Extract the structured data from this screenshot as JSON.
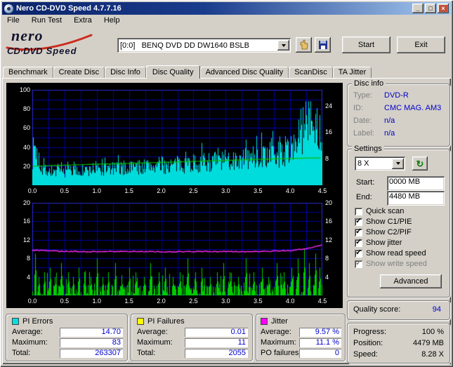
{
  "window": {
    "title": "Nero CD-DVD Speed 4.7.7.16",
    "menu": [
      "File",
      "Run Test",
      "Extra",
      "Help"
    ]
  },
  "icons": {
    "minimize": "_",
    "maximize": "□",
    "close": "×",
    "check": "✓",
    "refresh": "↻"
  },
  "logo": {
    "brand": "nero",
    "product_a": "CD·DVD",
    "product_b": "Speed"
  },
  "toolbar": {
    "drive": "[0:0]   BENQ DVD DD DW1640 BSLB",
    "start": "Start",
    "exit": "Exit"
  },
  "tabs": {
    "items": [
      "Benchmark",
      "Create Disc",
      "Disc Info",
      "Disc Quality",
      "Advanced Disc Quality",
      "ScanDisc",
      "TA Jitter"
    ],
    "selected": "Disc Quality"
  },
  "disc_info": {
    "title": "Disc info",
    "rows": [
      [
        "Type:",
        "DVD-R"
      ],
      [
        "ID:",
        "CMC MAG. AM3"
      ],
      [
        "Date:",
        "n/a"
      ],
      [
        "Label:",
        "n/a"
      ]
    ]
  },
  "settings": {
    "title": "Settings",
    "speed": "8 X",
    "start_label": "Start:",
    "start_value": "0000 MB",
    "end_label": "End:",
    "end_value": "4480 MB",
    "checkboxes": [
      {
        "label": "Quick scan",
        "checked": false,
        "disabled": false
      },
      {
        "label": "Show C1/PIE",
        "checked": true,
        "disabled": false
      },
      {
        "label": "Show C2/PIF",
        "checked": true,
        "disabled": false
      },
      {
        "label": "Show jitter",
        "checked": true,
        "disabled": false
      },
      {
        "label": "Show read speed",
        "checked": true,
        "disabled": false
      },
      {
        "label": "Show write speed",
        "checked": true,
        "disabled": true
      }
    ],
    "advanced": "Advanced"
  },
  "quality": {
    "label": "Quality score:",
    "value": "94"
  },
  "status": {
    "rows": [
      [
        "Progress:",
        "100 %"
      ],
      [
        "Position:",
        "4479 MB"
      ],
      [
        "Speed:",
        "8.28 X"
      ]
    ]
  },
  "stats": [
    {
      "title": "PI Errors",
      "swatch": "#00e0e0",
      "rows": [
        [
          "Average:",
          "14.70"
        ],
        [
          "Maximum:",
          "83"
        ],
        [
          "Total:",
          "263307"
        ]
      ]
    },
    {
      "title": "PI Failures",
      "swatch": "#ffff00",
      "rows": [
        [
          "Average:",
          "0.01"
        ],
        [
          "Maximum:",
          "11"
        ],
        [
          "Total:",
          "2055"
        ]
      ]
    },
    {
      "title": "Jitter",
      "swatch": "#ff00ff",
      "rows": [
        [
          "Average:",
          "9.57 %"
        ],
        [
          "Maximum:",
          "11.1 %"
        ],
        [
          "PO failures:",
          "0"
        ]
      ]
    }
  ],
  "chart_data": [
    {
      "type": "area",
      "name": "pi-errors-over-position",
      "x_max": 4.47,
      "x_tick_labels": [
        "0.0",
        "0.5",
        "1.0",
        "1.5",
        "2.0",
        "2.5",
        "3.0",
        "3.5",
        "4.0",
        "4.5"
      ],
      "y_left": {
        "max": 100,
        "ticks": [
          100,
          80,
          60,
          40,
          20
        ]
      },
      "y_right": {
        "max": 28.8,
        "ticks": [
          24,
          16,
          8
        ]
      },
      "v_grid_divisions": 18,
      "h_grid_divisions": 10,
      "series": [
        {
          "name": "PI Errors",
          "color": "#00dcdc",
          "axis": "left",
          "points": [
            [
              0,
              30
            ],
            [
              0.03,
              44
            ],
            [
              0.08,
              26
            ],
            [
              0.15,
              18
            ],
            [
              0.25,
              15
            ],
            [
              0.4,
              14
            ],
            [
              0.6,
              15
            ],
            [
              0.8,
              15
            ],
            [
              1.0,
              16
            ],
            [
              1.2,
              17
            ],
            [
              1.4,
              18
            ],
            [
              1.6,
              19
            ],
            [
              1.8,
              20
            ],
            [
              2.0,
              21
            ],
            [
              2.2,
              21
            ],
            [
              2.4,
              23
            ],
            [
              2.6,
              24
            ],
            [
              2.8,
              25
            ],
            [
              3.0,
              26
            ],
            [
              3.2,
              27
            ],
            [
              3.4,
              29
            ],
            [
              3.6,
              31
            ],
            [
              3.8,
              33
            ],
            [
              3.95,
              37
            ],
            [
              4.05,
              45
            ],
            [
              4.15,
              56
            ],
            [
              4.22,
              68
            ],
            [
              4.27,
              78
            ],
            [
              4.32,
              62
            ],
            [
              4.38,
              70
            ],
            [
              4.43,
              52
            ],
            [
              4.47,
              40
            ]
          ]
        },
        {
          "name": "Read speed",
          "color": "#00c000",
          "axis": "right",
          "points": [
            [
              0,
              5.75
            ],
            [
              0.5,
              6.05
            ],
            [
              1.0,
              6.35
            ],
            [
              1.5,
              6.6
            ],
            [
              2.0,
              6.9
            ],
            [
              2.5,
              7.2
            ],
            [
              3.0,
              7.5
            ],
            [
              3.5,
              7.8
            ],
            [
              4.0,
              8.1
            ],
            [
              4.47,
              8.28
            ]
          ]
        }
      ]
    },
    {
      "type": "bar",
      "name": "pi-failures-and-jitter-over-position",
      "x_max": 4.47,
      "x_tick_labels": [
        "0.0",
        "0.5",
        "1.0",
        "1.5",
        "2.0",
        "2.5",
        "3.0",
        "3.5",
        "4.0",
        "4.5"
      ],
      "y_left": {
        "max": 20,
        "ticks": [
          20,
          16,
          12,
          8,
          4
        ]
      },
      "y_right": {
        "max": 20,
        "ticks": [
          20,
          16,
          12,
          8,
          4
        ]
      },
      "v_grid_divisions": 18,
      "h_grid_divisions": 10,
      "series": [
        {
          "name": "PI Failures",
          "color": "#00cc00",
          "axis": "left",
          "baseline_max": 2.4,
          "spikes": [
            [
              0.04,
              9
            ],
            [
              0.1,
              4
            ],
            [
              0.18,
              5
            ],
            [
              0.27,
              6
            ],
            [
              0.35,
              4
            ],
            [
              0.45,
              7
            ],
            [
              0.55,
              5
            ],
            [
              0.63,
              4
            ],
            [
              0.72,
              6
            ],
            [
              0.8,
              5
            ],
            [
              0.9,
              4
            ],
            [
              1.0,
              8
            ],
            [
              1.08,
              4
            ],
            [
              1.17,
              5
            ],
            [
              1.28,
              7
            ],
            [
              1.38,
              4
            ],
            [
              1.5,
              6
            ],
            [
              1.6,
              5
            ],
            [
              1.72,
              4
            ],
            [
              1.82,
              7
            ],
            [
              1.95,
              5
            ],
            [
              2.05,
              6
            ],
            [
              2.17,
              4
            ],
            [
              2.28,
              5
            ],
            [
              2.4,
              8
            ],
            [
              2.52,
              5
            ],
            [
              2.62,
              6
            ],
            [
              2.75,
              4
            ],
            [
              2.85,
              5
            ],
            [
              2.95,
              7
            ],
            [
              3.05,
              5
            ],
            [
              3.18,
              4
            ],
            [
              3.3,
              8
            ],
            [
              3.42,
              5
            ],
            [
              3.55,
              6
            ],
            [
              3.65,
              4
            ],
            [
              3.78,
              7
            ],
            [
              3.88,
              5
            ],
            [
              4.0,
              6
            ],
            [
              4.1,
              8
            ],
            [
              4.2,
              10
            ],
            [
              4.28,
              7
            ],
            [
              4.37,
              9
            ],
            [
              4.44,
              6
            ]
          ]
        },
        {
          "name": "Jitter",
          "color": "#ff2bff",
          "axis": "right",
          "points": [
            [
              0,
              9.8
            ],
            [
              0.4,
              9.55
            ],
            [
              0.9,
              9.45
            ],
            [
              1.5,
              9.5
            ],
            [
              2.1,
              9.4
            ],
            [
              2.7,
              9.5
            ],
            [
              3.2,
              9.45
            ],
            [
              3.7,
              9.55
            ],
            [
              4.0,
              9.7
            ],
            [
              4.25,
              10.1
            ],
            [
              4.4,
              10.6
            ],
            [
              4.47,
              10.9
            ]
          ]
        }
      ]
    }
  ]
}
